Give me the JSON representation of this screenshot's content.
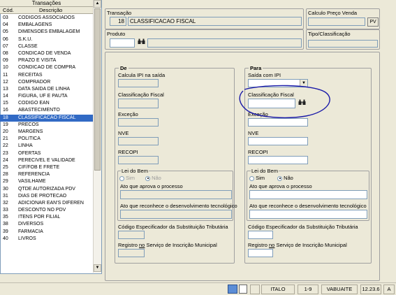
{
  "transactions": {
    "title": "Transações",
    "col_code": "Cód.",
    "col_desc": "Descrição",
    "items": [
      {
        "code": "03",
        "label": "CODIGOS ASSOCIADOS"
      },
      {
        "code": "04",
        "label": "EMBALAGENS"
      },
      {
        "code": "05",
        "label": "DIMENSOES EMBALAGEM"
      },
      {
        "code": "06",
        "label": "S.K.U."
      },
      {
        "code": "07",
        "label": "CLASSE"
      },
      {
        "code": "08",
        "label": "CONDICAO DE VENDA"
      },
      {
        "code": "09",
        "label": "PRAZO E VISITA"
      },
      {
        "code": "10",
        "label": "CONDICAO DE COMPRA"
      },
      {
        "code": "11",
        "label": "RECEITAS"
      },
      {
        "code": "12",
        "label": "COMPRADOR"
      },
      {
        "code": "13",
        "label": "DATA SAIDA DE LINHA"
      },
      {
        "code": "14",
        "label": "FIGURA, UF E PAUTA"
      },
      {
        "code": "15",
        "label": "CODIGO EAN"
      },
      {
        "code": "16",
        "label": "ABASTECIMENTO"
      },
      {
        "code": "18",
        "label": "CLASSIFICACAO FISCAL"
      },
      {
        "code": "19",
        "label": "PRECOS"
      },
      {
        "code": "20",
        "label": "MARGENS"
      },
      {
        "code": "21",
        "label": "POLITICA"
      },
      {
        "code": "22",
        "label": "LINHA"
      },
      {
        "code": "23",
        "label": "OFERTAS"
      },
      {
        "code": "24",
        "label": "PERECIVEL E VALIDADE"
      },
      {
        "code": "25",
        "label": "CIF/FOB E FRETE"
      },
      {
        "code": "28",
        "label": "REFERENCIA"
      },
      {
        "code": "29",
        "label": "VASILHAME"
      },
      {
        "code": "30",
        "label": "QTDE AUTORIZADA PDV"
      },
      {
        "code": "31",
        "label": "DIAS DE PROTECAO"
      },
      {
        "code": "32",
        "label": "ADICIONAR EAN'S DIFEREN"
      },
      {
        "code": "33",
        "label": "DESCONTO NO PDV"
      },
      {
        "code": "35",
        "label": "ITENS POR FILIAL"
      },
      {
        "code": "38",
        "label": "DIVERSOS"
      },
      {
        "code": "39",
        "label": "FARMACIA"
      },
      {
        "code": "40",
        "label": "LIVROS"
      }
    ],
    "selected_index": 14
  },
  "header": {
    "transacao_label": "Transação",
    "transacao_code": "18",
    "transacao_name": "CLASSIFICACAO FISCAL",
    "produto_label": "Produto",
    "calc_preco_label": "Calculo Preço Venda",
    "pv_button": "PV",
    "tipo_label": "Tipo/Classificação"
  },
  "de": {
    "title": "De",
    "calcula_ipi": "Calcula IPI na saída",
    "classificacao": "Classificação Fiscal",
    "excecao": "Exceção",
    "nve": "NVE",
    "recopi": "RECOPI",
    "lei_title": "Lei do Bem",
    "sim": "Sim",
    "nao": "Não",
    "ato_aprova": "Ato que aprova o processo",
    "ato_reconhece": "Ato que reconhece o desenvolvimento tecnológico",
    "codigo_esp": "Código Especificador da Substituição Tributária",
    "registro_pre": "Registro ",
    "registro_u": "no",
    "registro_post": " Serviço de Inscrição Municipal"
  },
  "para": {
    "title": "Para",
    "saida_ipi": "Saída com IPI",
    "classificacao": "Classificação Fiscal",
    "excecao": "Exceção",
    "nve": "NVE",
    "recopi": "RECOPI",
    "lei_title": "Lei do Bem",
    "sim": "Sim",
    "nao": "Não",
    "ato_aprova": "Ato que aprova o processo",
    "ato_reconhece": "Ato que reconhece o desenvolvimento tecnológico",
    "codigo_esp": "Código Especificador da Substituição Tributária",
    "registro_pre": "Registro ",
    "registro_u": "no",
    "registro_post": " Serviço de Inscrição Municipal"
  },
  "status": {
    "user": "ITALO",
    "range": "1-9",
    "store": "VABUAITE",
    "version": "12.23.6",
    "extra": "A"
  },
  "colors": {
    "selection": "#316ac5",
    "annotation": "#1a1aa8",
    "window_bg": "#ece9d8"
  }
}
